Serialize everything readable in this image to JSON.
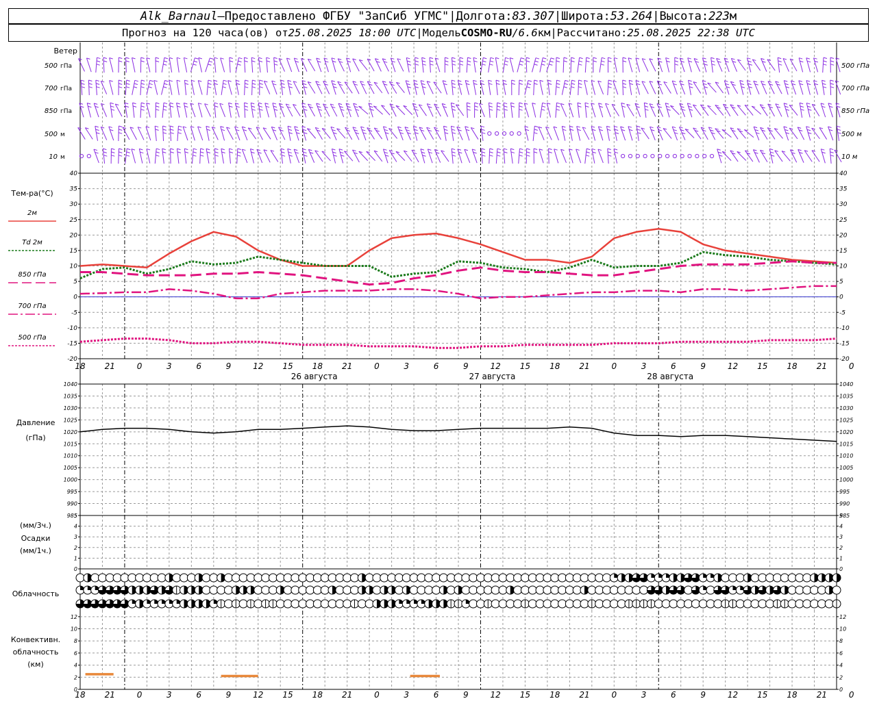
{
  "header": {
    "station": "Alk_Barnaul",
    "dash": " – ",
    "provided": "Предоставлено ФГБУ \"ЗапСиб УГМС\"",
    "sep": " | ",
    "lon_label": "Долгота: ",
    "lon_value": "83.307",
    "lat_label": "Широта: ",
    "lat_value": "53.264",
    "alt_label": "Высота: ",
    "alt_value": "223",
    "alt_unit": "м",
    "forecast_prefix": "Прогноз на 120 часа(ов) от ",
    "forecast_start": "25.08.2025 18:00 UTC",
    "model_label": "Модель ",
    "model_name": "COSMO-RU",
    "model_slash": " / ",
    "model_res": "6.6",
    "model_res_unit": "км",
    "calc_label": "Рассчитано: ",
    "calc_time": "25.08.2025 22:38 UTC"
  },
  "colors": {
    "wind": "#8a2be2",
    "t2m": "#e8413a",
    "td2m": "#1b7a1b",
    "t850": "#e0137f",
    "t700": "#e0137f",
    "t500": "#e0137f",
    "zero_line": "#3333cc",
    "pressure": "#000000",
    "convective": "#e8883a",
    "grid": "#999999"
  },
  "chart_data": [
    {
      "type": "wind-barbs",
      "title": "Ветер",
      "levels": [
        "500 гПа",
        "700 гПа",
        "850 гПа",
        "500 м",
        "10 м"
      ],
      "x_hours": {
        "start": 0,
        "end": 102,
        "step": 1
      }
    },
    {
      "type": "line",
      "ylabel": "Тем-ра(°С)",
      "ylim": [
        -20,
        40
      ],
      "yticks": [
        -20,
        -15,
        -10,
        -5,
        0,
        5,
        10,
        15,
        20,
        25,
        30,
        35,
        40
      ],
      "x_ticks": [
        "18",
        "21",
        "0",
        "3",
        "6",
        "9",
        "12",
        "15",
        "18",
        "21",
        "0",
        "3",
        "6",
        "9",
        "12",
        "15",
        "18",
        "21",
        "0",
        "3",
        "6",
        "9",
        "12",
        "15",
        "18",
        "21",
        "0"
      ],
      "x_dates": [
        "26 августа",
        "27 августа",
        "28 августа"
      ],
      "legend": [
        {
          "key": "t2m",
          "label": "2м",
          "style": "solid"
        },
        {
          "key": "td2m",
          "label": "Td  2м",
          "style": "dotted"
        },
        {
          "key": "t850",
          "label": "850 гПа",
          "style": "dashed"
        },
        {
          "key": "t700",
          "label": "700 гПа",
          "style": "dashdot"
        },
        {
          "key": "t500",
          "label": "500 гПа",
          "style": "dotted"
        }
      ],
      "series": [
        {
          "key": "t2m",
          "x": [
            0,
            3,
            6,
            9,
            12,
            15,
            18,
            21,
            24,
            27,
            30,
            33,
            36,
            39,
            42,
            45,
            48,
            51,
            54,
            57,
            60,
            63,
            66,
            69,
            72,
            75,
            78,
            81,
            84,
            87,
            90,
            93,
            96,
            99,
            102
          ],
          "values": [
            10,
            10.5,
            10,
            9.5,
            14,
            18,
            21,
            19.5,
            15,
            12,
            10,
            10,
            10,
            15,
            19,
            20,
            20.5,
            19,
            17,
            14.5,
            12,
            12,
            11,
            13,
            19,
            21,
            22,
            21,
            17,
            15,
            14,
            13,
            12,
            11.5,
            11
          ]
        },
        {
          "key": "td2m",
          "x": [
            0,
            3,
            6,
            9,
            12,
            15,
            18,
            21,
            24,
            27,
            30,
            33,
            36,
            39,
            42,
            45,
            48,
            51,
            54,
            57,
            60,
            63,
            66,
            69,
            72,
            75,
            78,
            81,
            84,
            87,
            90,
            93,
            96,
            99,
            102
          ],
          "values": [
            6,
            9,
            9.5,
            7.5,
            9,
            11.5,
            10.5,
            11,
            13,
            12,
            11,
            10,
            10,
            10,
            6.5,
            7.5,
            8,
            11.5,
            11,
            9.5,
            9,
            8,
            9.5,
            12,
            9.5,
            10,
            10,
            11,
            14.5,
            13.5,
            13,
            12,
            11.5,
            11,
            10.5
          ]
        },
        {
          "key": "t850",
          "x": [
            0,
            3,
            6,
            9,
            12,
            15,
            18,
            21,
            24,
            27,
            30,
            33,
            36,
            39,
            42,
            45,
            48,
            51,
            54,
            57,
            60,
            63,
            66,
            69,
            72,
            75,
            78,
            81,
            84,
            87,
            90,
            93,
            96,
            99,
            102
          ],
          "values": [
            8,
            8,
            7.5,
            7,
            7,
            7,
            7.5,
            7.5,
            8,
            7.5,
            7,
            6,
            5,
            4,
            4.5,
            6,
            7,
            8.5,
            9.5,
            8.5,
            8,
            8,
            7.5,
            7,
            7,
            8,
            9,
            10,
            10.5,
            10.5,
            10.5,
            11,
            11.5,
            11,
            11
          ]
        },
        {
          "key": "t700",
          "x": [
            0,
            3,
            6,
            9,
            12,
            15,
            18,
            21,
            24,
            27,
            30,
            33,
            36,
            39,
            42,
            45,
            48,
            51,
            54,
            57,
            60,
            63,
            66,
            69,
            72,
            75,
            78,
            81,
            84,
            87,
            90,
            93,
            96,
            99,
            102
          ],
          "values": [
            1,
            1.2,
            1.5,
            1.5,
            2.5,
            2,
            1,
            -0.5,
            -0.5,
            1,
            1.5,
            2,
            2,
            2,
            2.5,
            2.5,
            2,
            1,
            -0.5,
            0,
            0,
            0.5,
            1,
            1.5,
            1.5,
            2,
            2,
            1.5,
            2.5,
            2.5,
            2,
            2.5,
            3,
            3.5,
            3.5
          ]
        },
        {
          "key": "t500",
          "x": [
            0,
            3,
            6,
            9,
            12,
            15,
            18,
            21,
            24,
            27,
            30,
            33,
            36,
            39,
            42,
            45,
            48,
            51,
            54,
            57,
            60,
            63,
            66,
            69,
            72,
            75,
            78,
            81,
            84,
            87,
            90,
            93,
            96,
            99,
            102
          ],
          "values": [
            -14.5,
            -14,
            -13.5,
            -13.5,
            -14,
            -15,
            -15,
            -14.5,
            -14.5,
            -15,
            -15.5,
            -15.5,
            -15.5,
            -16,
            -16,
            -16,
            -16.5,
            -16.5,
            -16,
            -16,
            -15.5,
            -15.5,
            -15.5,
            -15.5,
            -15,
            -15,
            -15,
            -14.5,
            -14.5,
            -14.5,
            -14.5,
            -14,
            -14,
            -14,
            -13.5
          ]
        }
      ]
    },
    {
      "type": "line",
      "ylabel": "Давление",
      "yunit": "(гПа)",
      "ylim": [
        985,
        1040
      ],
      "yticks": [
        985,
        990,
        995,
        1000,
        1005,
        1010,
        1015,
        1020,
        1025,
        1030,
        1035,
        1040
      ],
      "series": [
        {
          "key": "pressure",
          "x": [
            0,
            3,
            6,
            9,
            12,
            15,
            18,
            21,
            24,
            27,
            30,
            33,
            36,
            39,
            42,
            45,
            48,
            51,
            54,
            57,
            60,
            63,
            66,
            69,
            72,
            75,
            78,
            81,
            84,
            87,
            90,
            93,
            96,
            99,
            102
          ],
          "values": [
            1020,
            1021,
            1021.5,
            1021.5,
            1021,
            1020,
            1019.5,
            1020,
            1021,
            1021,
            1021.5,
            1022,
            1022.5,
            1022,
            1021,
            1020.5,
            1020.5,
            1021,
            1021.5,
            1021.5,
            1021.5,
            1021.5,
            1022,
            1021.5,
            1019.5,
            1018.5,
            1018.5,
            1018,
            1018.5,
            1018.5,
            1018,
            1017.5,
            1017,
            1016.5,
            1016
          ]
        }
      ]
    },
    {
      "type": "bar",
      "ylabel": "Осадки",
      "ylabel_top": "(мм/3ч.)",
      "ylabel_bottom": "(мм/1ч.)",
      "ylim": [
        0,
        5
      ],
      "yticks": [
        0,
        1,
        2,
        3,
        4,
        5
      ],
      "values": []
    },
    {
      "type": "cloud-cover",
      "ylabel": "Облачность",
      "rows": [
        "верхняя",
        "средняя",
        "нижняя"
      ],
      "x_hours": {
        "start": 0,
        "end": 102,
        "step": 1
      }
    },
    {
      "type": "bar",
      "ylabel_lines": [
        "Конвективн.",
        "облачность",
        "(км)"
      ],
      "ylim": [
        0,
        13
      ],
      "yticks": [
        0,
        2,
        4,
        6,
        8,
        10,
        12
      ],
      "segments": [
        {
          "x0": 0.7,
          "x1": 4.5,
          "y": 2.5
        },
        {
          "x0": 19,
          "x1": 24,
          "y": 2.2
        },
        {
          "x0": 44.5,
          "x1": 48.5,
          "y": 2.2
        }
      ]
    }
  ]
}
